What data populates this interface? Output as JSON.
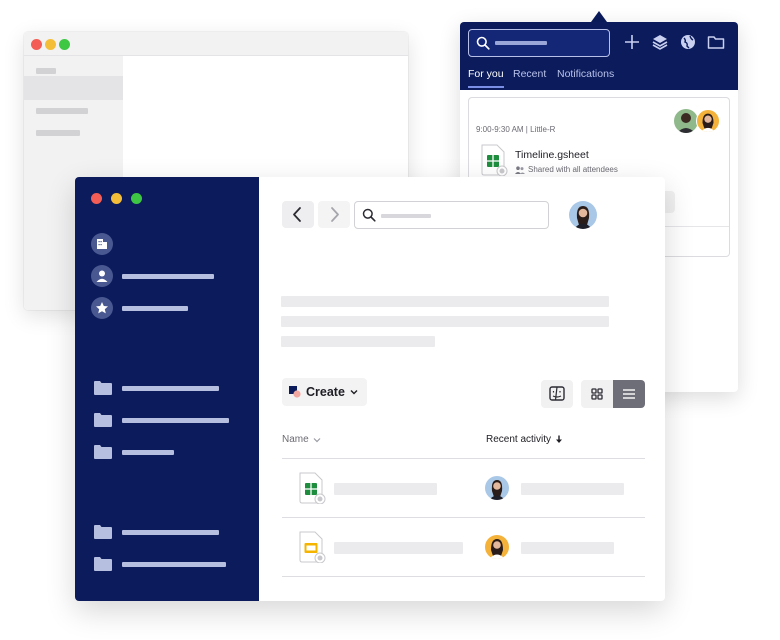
{
  "popup": {
    "tabs": [
      {
        "label": "For you",
        "active": true
      },
      {
        "label": "Recent",
        "active": false
      },
      {
        "label": "Notifications",
        "active": false
      }
    ],
    "event_meta": "9:00-9:30 AM | Little-R",
    "file_name": "Timeline.gsheet",
    "shared_text": "Shared with all attendees"
  },
  "main": {
    "create_label": "Create",
    "columns": {
      "name": "Name",
      "recent_activity": "Recent activity"
    }
  },
  "colors": {
    "navy": "#0b1b5c",
    "sheets_green": "#1e8e3e",
    "slides_yellow": "#f4b400",
    "active_toggle": "#6e6e78"
  }
}
